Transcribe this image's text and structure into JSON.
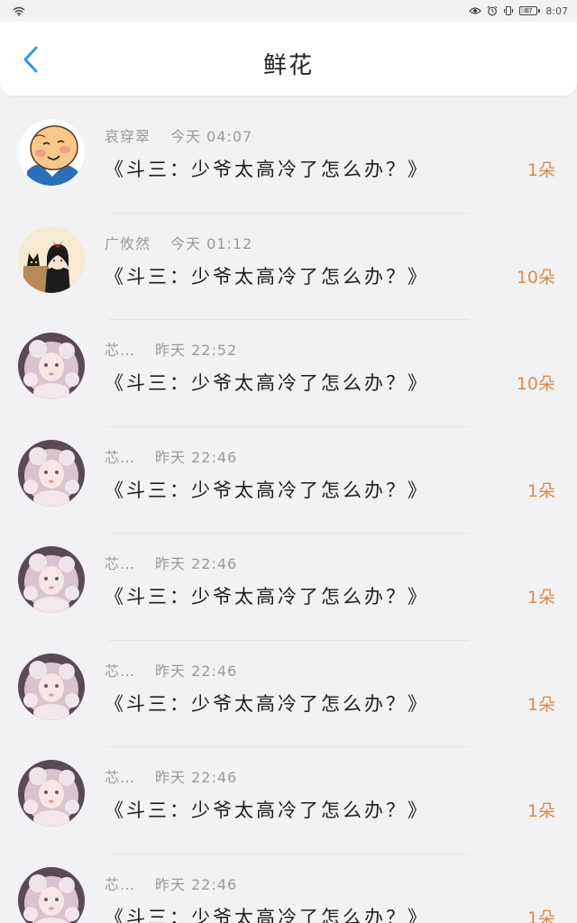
{
  "status_bar": {
    "battery_level": "67",
    "time": "8:07",
    "icons": [
      "wifi-icon",
      "eye-icon",
      "alarm-icon",
      "vibrate-icon",
      "battery-icon"
    ]
  },
  "header": {
    "title": "鲜花",
    "back_icon": "chevron-left-icon"
  },
  "colors": {
    "accent": "#2e9ae0",
    "count": "#d98b4f",
    "meta": "#9a9a9a",
    "background": "#f2f2f4"
  },
  "items": [
    {
      "user": "哀穿翠",
      "time": "今天 04:07",
      "title": "《斗三：少爷太高冷了怎么办？》",
      "count": "1朵",
      "avatar": "cartoon-man"
    },
    {
      "user": "广攸然",
      "time": "今天 01:12",
      "title": "《斗三：少爷太高冷了怎么办？》",
      "count": "10朵",
      "avatar": "girl-with-cat"
    },
    {
      "user": "芯…",
      "time": "昨天 22:52",
      "title": "《斗三：少爷太高冷了怎么办？》",
      "count": "10朵",
      "avatar": "pink-doll"
    },
    {
      "user": "芯…",
      "time": "昨天 22:46",
      "title": "《斗三：少爷太高冷了怎么办？》",
      "count": "1朵",
      "avatar": "pink-doll"
    },
    {
      "user": "芯…",
      "time": "昨天 22:46",
      "title": "《斗三：少爷太高冷了怎么办？》",
      "count": "1朵",
      "avatar": "pink-doll"
    },
    {
      "user": "芯…",
      "time": "昨天 22:46",
      "title": "《斗三：少爷太高冷了怎么办？》",
      "count": "1朵",
      "avatar": "pink-doll"
    },
    {
      "user": "芯…",
      "time": "昨天 22:46",
      "title": "《斗三：少爷太高冷了怎么办？》",
      "count": "1朵",
      "avatar": "pink-doll"
    },
    {
      "user": "芯…",
      "time": "昨天 22:46",
      "title": "《斗三：少爷太高冷了怎么办？》",
      "count": "1朵",
      "avatar": "pink-doll"
    }
  ]
}
